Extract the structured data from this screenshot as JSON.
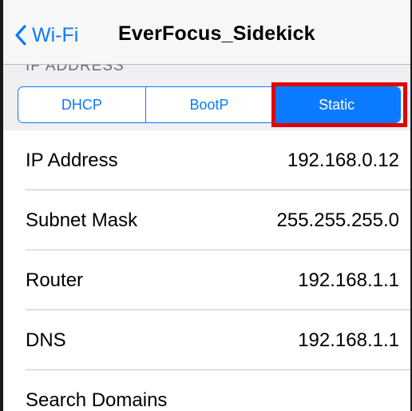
{
  "nav": {
    "back_label": "Wi-Fi",
    "title": "EverFocus_Sidekick"
  },
  "section": {
    "header": "IP ADDRESS"
  },
  "segments": [
    {
      "label": "DHCP",
      "selected": false
    },
    {
      "label": "BootP",
      "selected": false
    },
    {
      "label": "Static",
      "selected": true
    }
  ],
  "rows": [
    {
      "label": "IP Address",
      "value": "192.168.0.12"
    },
    {
      "label": "Subnet Mask",
      "value": "255.255.255.0"
    },
    {
      "label": "Router",
      "value": "192.168.1.1"
    },
    {
      "label": "DNS",
      "value": "192.168.1.1"
    },
    {
      "label": "Search Domains",
      "value": ""
    }
  ],
  "colors": {
    "accent": "#0a7aff",
    "highlight": "#e00000",
    "group_background": "#efeff4"
  }
}
